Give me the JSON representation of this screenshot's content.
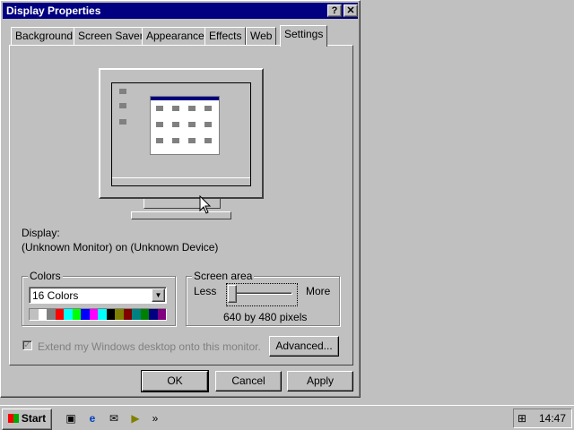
{
  "window": {
    "title": "Display Properties",
    "help_btn": "?",
    "close_btn": "✕"
  },
  "tabs": [
    {
      "label": "Background"
    },
    {
      "label": "Screen Saver"
    },
    {
      "label": "Appearance"
    },
    {
      "label": "Effects"
    },
    {
      "label": "Web"
    },
    {
      "label": "Settings"
    }
  ],
  "display": {
    "label": "Display:",
    "value": "(Unknown Monitor) on (Unknown Device)"
  },
  "colors": {
    "legend": "Colors",
    "selected": "16 Colors",
    "palette": [
      "#c0c0c0",
      "#ffffff",
      "#808080",
      "#ff0000",
      "#00ffff",
      "#00ff00",
      "#0000ff",
      "#ff00ff",
      "#00ffff",
      "#000000",
      "#808000",
      "#800000",
      "#008080",
      "#008000",
      "#000080",
      "#800080"
    ]
  },
  "screen_area": {
    "legend": "Screen area",
    "less": "Less",
    "more": "More",
    "value": "640 by 480 pixels"
  },
  "extend": {
    "label": "Extend my Windows desktop onto this monitor."
  },
  "buttons": {
    "advanced": "Advanced...",
    "ok": "OK",
    "cancel": "Cancel",
    "apply": "Apply"
  },
  "taskbar": {
    "start": "Start",
    "more": "»",
    "clock": "14:47"
  }
}
